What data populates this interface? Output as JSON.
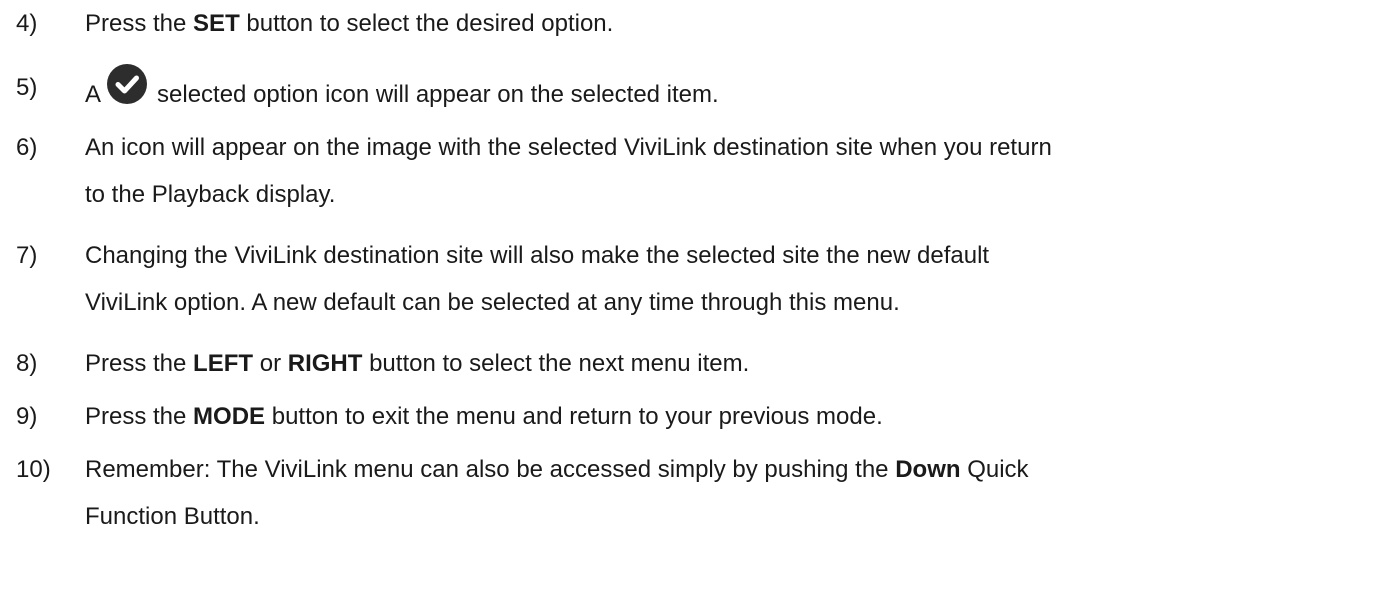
{
  "steps": [
    {
      "num": "4)",
      "line1": {
        "a": "Press the ",
        "b": "SET",
        "c": " button to select the desired option."
      }
    },
    {
      "num": "5)",
      "line1": {
        "a": "A",
        "c": "selected option icon will appear on the selected item."
      },
      "icon": "check-circle-icon"
    },
    {
      "num": "6)",
      "line1": {
        "a": "An icon will appear on the image with the selected ViviLink destination site when you return"
      },
      "line2": {
        "a": "to the Playback display."
      }
    },
    {
      "num": "7)",
      "line1": {
        "a": "Changing the ViviLink destination site will also make the selected site the new default"
      },
      "line2": {
        "a": "ViviLink option. A new default can be selected at any time through this menu."
      }
    },
    {
      "num": "8)",
      "line1": {
        "a": "Press the ",
        "b": "LEFT",
        "c": " or ",
        "d": "RIGHT",
        "e": " button to select the next menu item."
      }
    },
    {
      "num": "9)",
      "line1": {
        "a": "Press the ",
        "b": "MODE",
        "c": " button to exit the menu and return to your previous mode."
      }
    },
    {
      "num": "10)",
      "line1": {
        "a": "Remember: The ViviLink menu can also be accessed simply by pushing the ",
        "b": "Down",
        "c": " Quick"
      },
      "line2": {
        "a": "Function Button."
      }
    }
  ]
}
